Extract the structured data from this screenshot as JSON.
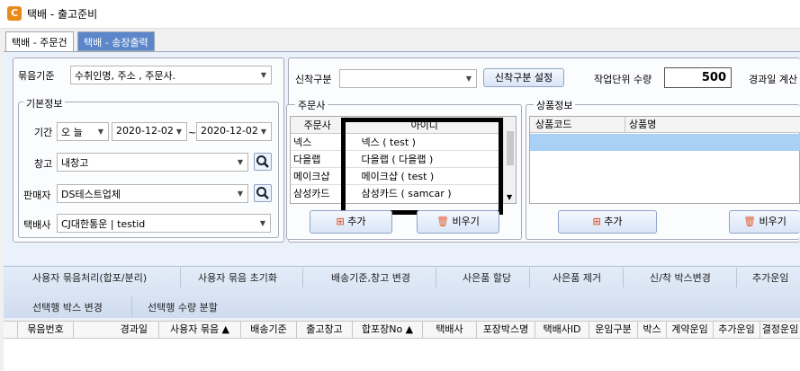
{
  "window": {
    "title": "택배 - 출고준비",
    "icon_letter": "C"
  },
  "tabs": [
    {
      "label": "택배 - 주문건"
    },
    {
      "label": "택배 - 송장출력"
    }
  ],
  "filters": {
    "bundle_label": "묶음기준",
    "bundle_value": "수취인명, 주소 , 주문사.",
    "inout_label": "신착구분",
    "inout_value": "",
    "inout_button": "신착구분 설정",
    "work_unit_label": "작업단위 수량",
    "work_unit_value": "500",
    "elapsed_label": "경과일 계산"
  },
  "basic": {
    "title": "기본정보",
    "period_label": "기간",
    "period_value": "오 늘",
    "date_from": "2020-12-02",
    "date_sep": "~",
    "date_to": "2020-12-02",
    "warehouse_label": "창고",
    "warehouse_value": "내창고",
    "seller_label": "판매자",
    "seller_value": "DS테스트업체",
    "courier_label": "택배사",
    "courier_value": "CJ대한통운 | testid"
  },
  "orderer": {
    "title": "주문사",
    "col1": "주문사",
    "col2": "아이디",
    "rows": [
      {
        "name": "넥스",
        "id": "넥스 ( test )"
      },
      {
        "name": "다을랩",
        "id": "다을랩 ( 다을랩 )"
      },
      {
        "name": "메이크샵",
        "id": "메이크샵 ( test )"
      },
      {
        "name": "삼성카드",
        "id": "삼성카드 ( samcar )"
      }
    ],
    "add_button": "추가",
    "clear_button": "비우기"
  },
  "product": {
    "title": "상품정보",
    "col1": "상품코드",
    "col2": "상품명",
    "add_button": "추가",
    "clear_button": "비우기"
  },
  "toolbar": {
    "row1": [
      "사용자 묶음처리(합포/분리)",
      "사용자 묶음 초기화",
      "배송기준,창고 변경",
      "사은품 할당",
      "사은품 제거",
      "신/착 박스변경",
      "추가운임"
    ],
    "row2": [
      "선택행 박스 변경",
      "선택행 수량 분할"
    ]
  },
  "grid": {
    "columns": [
      "묶음번호",
      "경과일",
      "사용자 묶음 ▲",
      "배송기준",
      "출고창고",
      "합포장No ▲",
      "택배사",
      "포장박스명",
      "택배사ID",
      "운임구분",
      "박스",
      "계약운임",
      "추가운임",
      "결정운임"
    ]
  }
}
